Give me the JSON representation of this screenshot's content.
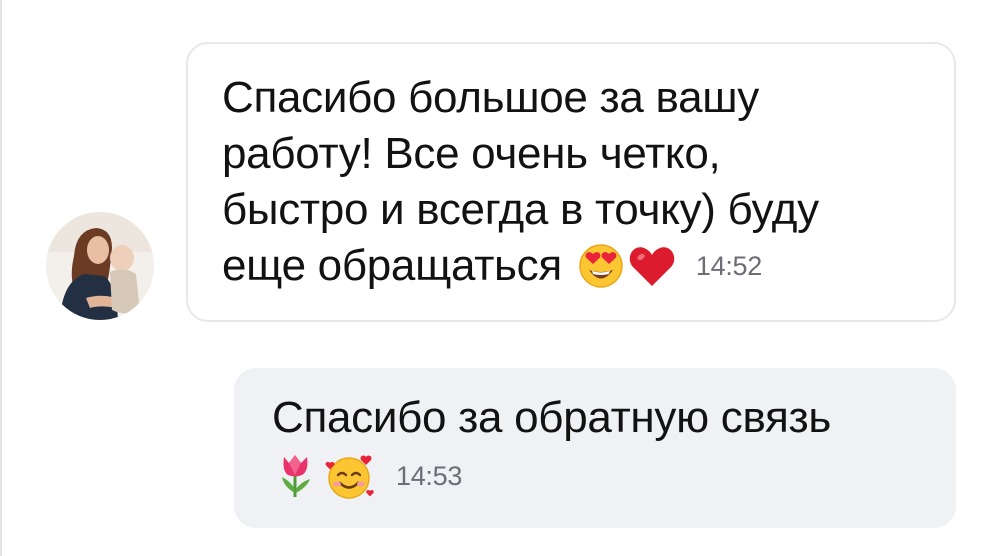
{
  "conversation": {
    "messages": [
      {
        "direction": "incoming",
        "lines": [
          "Спасибо большое за вашу",
          "работу! Все очень четко,",
          "быстро и всегда в точку) буду",
          "еще обращаться"
        ],
        "emojis": [
          "heart-eyes-emoji",
          "red-heart-emoji"
        ],
        "time": "14:52"
      },
      {
        "direction": "outgoing",
        "lines": [
          "Спасибо за обратную связь"
        ],
        "emojis": [
          "tulip-emoji",
          "smiling-face-with-hearts-emoji"
        ],
        "time": "14:53"
      }
    ]
  },
  "colors": {
    "incoming_bubble_bg": "#ffffff",
    "incoming_bubble_border": "#e6e8ec",
    "outgoing_bubble_bg": "#eff1f4",
    "text": "#121212",
    "time": "#6b6f75"
  }
}
